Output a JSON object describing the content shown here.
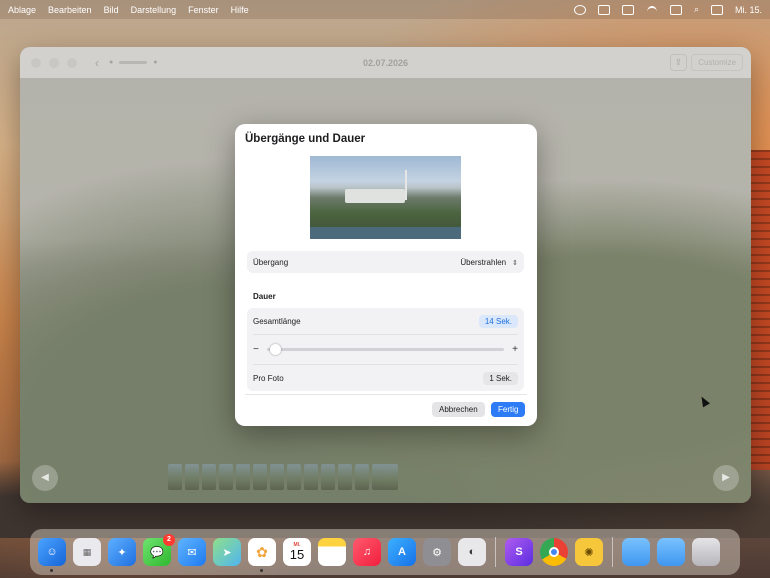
{
  "menubar": {
    "items": [
      "Ablage",
      "Bearbeiten",
      "Bild",
      "Darstellung",
      "Fenster",
      "Hilfe"
    ],
    "clock": "Mi. 15."
  },
  "window": {
    "title": "02.07.2026",
    "customize_label": "Customize",
    "share_icon": "share-icon"
  },
  "dialog": {
    "title": "Übergänge und Dauer",
    "transition_label": "Übergang",
    "transition_value": "Überstrahlen",
    "section_duration": "Dauer",
    "total_label": "Gesamtlänge",
    "total_value": "14 Sek.",
    "slider_minus": "−",
    "slider_plus": "+",
    "slider_level": 0.02,
    "per_photo_label": "Pro Foto",
    "per_photo_value": "1 Sek.",
    "cancel_label": "Abbrechen",
    "done_label": "Fertig"
  },
  "dock": {
    "messages_badge": "2",
    "calendar_weekday": "MI.",
    "calendar_day": "15"
  },
  "colors": {
    "accent": "#2d7cf6",
    "accent_light": "#dbe8fb"
  }
}
